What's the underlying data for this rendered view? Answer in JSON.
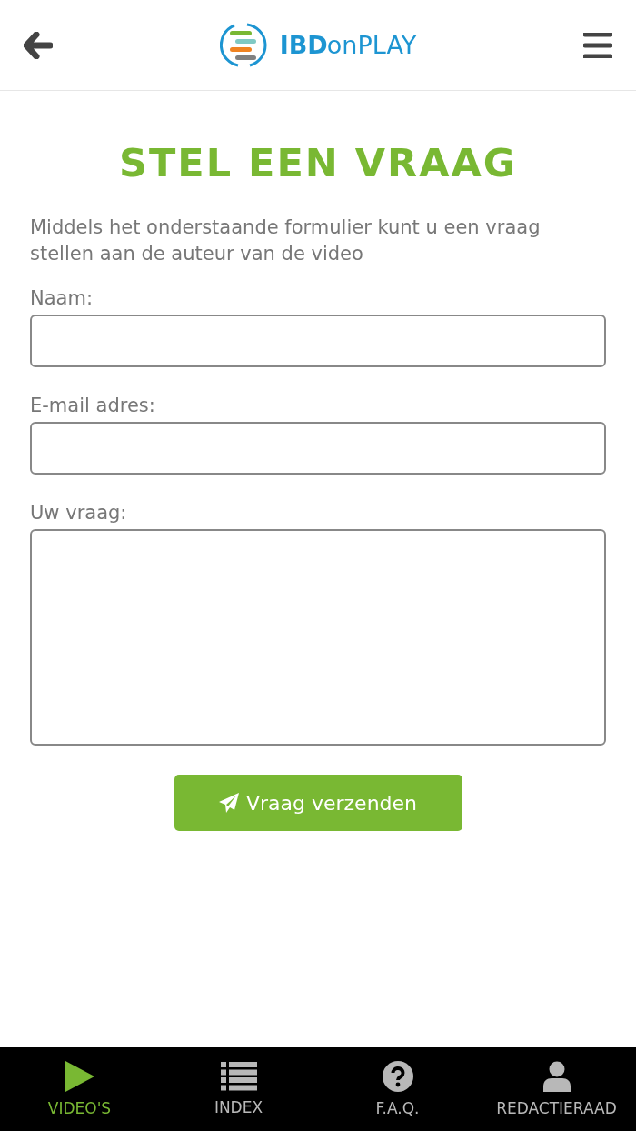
{
  "header": {
    "logo": {
      "brand": "IBD",
      "product": "onPLAY"
    }
  },
  "title": "STEL EEN VRAAG",
  "intro": "Middels het onderstaande formulier kunt u een vraag stellen aan de auteur van de video",
  "fields": [
    {
      "label": "Naam:",
      "kind": "input"
    },
    {
      "label": "E-mail adres:",
      "kind": "input"
    },
    {
      "label": "Uw vraag:",
      "kind": "textarea"
    }
  ],
  "submit": "Vraag verzenden",
  "nav": [
    {
      "label": "VIDEO'S",
      "kind": "play",
      "selected": true
    },
    {
      "label": "INDEX",
      "kind": "list",
      "selected": false
    },
    {
      "label": "F.A.Q.",
      "kind": "question",
      "selected": false
    },
    {
      "label": "REDACTIERAAD",
      "kind": "person",
      "selected": false
    }
  ]
}
